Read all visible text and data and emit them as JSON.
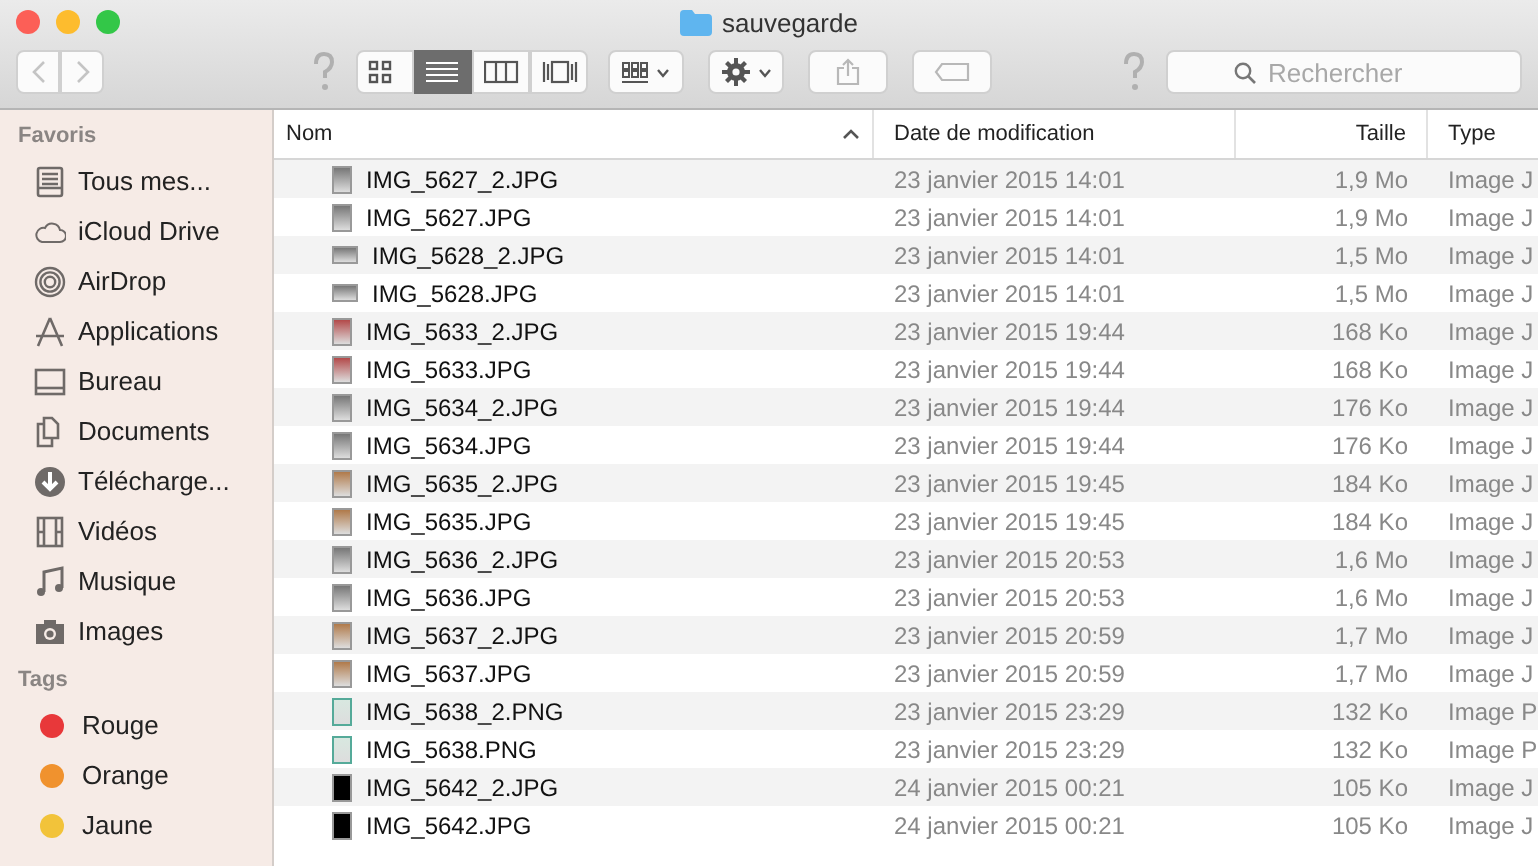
{
  "window": {
    "title": "sauvegarde"
  },
  "toolbar": {
    "view_modes": [
      {
        "kind": "icons",
        "selected": false
      },
      {
        "kind": "list",
        "selected": true
      },
      {
        "kind": "columns",
        "selected": false
      },
      {
        "kind": "coverflow",
        "selected": false
      }
    ],
    "search": {
      "placeholder": "Rechercher"
    }
  },
  "sidebar": {
    "sections": [
      {
        "title": "Favoris",
        "items": [
          {
            "kind": "all",
            "label": "Tous mes..."
          },
          {
            "kind": "cloud",
            "label": "iCloud Drive"
          },
          {
            "kind": "airdrop",
            "label": "AirDrop"
          },
          {
            "kind": "apps",
            "label": "Applications"
          },
          {
            "kind": "desktop",
            "label": "Bureau"
          },
          {
            "kind": "docs",
            "label": "Documents"
          },
          {
            "kind": "download",
            "label": "Télécharge..."
          },
          {
            "kind": "movies",
            "label": "Vidéos"
          },
          {
            "kind": "music",
            "label": "Musique"
          },
          {
            "kind": "pictures",
            "label": "Images"
          }
        ]
      },
      {
        "title": "Tags",
        "items": [
          {
            "kind": "tag",
            "label": "Rouge",
            "color": "#e8383a"
          },
          {
            "kind": "tag",
            "label": "Orange",
            "color": "#f0922e"
          },
          {
            "kind": "tag",
            "label": "Jaune",
            "color": "#f2c33a"
          }
        ]
      }
    ]
  },
  "table": {
    "columns": [
      {
        "label": "Nom",
        "sorted": true
      },
      {
        "label": "Date de modification",
        "sorted": false
      },
      {
        "label": "Taille",
        "sorted": false
      },
      {
        "label": "Type",
        "sorted": false
      }
    ],
    "rows": [
      {
        "kind": "portrait",
        "name": "IMG_5627_2.JPG",
        "date": "23 janvier 2015 14:01",
        "size": "1,9 Mo",
        "type": "Image J"
      },
      {
        "kind": "portrait",
        "name": "IMG_5627.JPG",
        "date": "23 janvier 2015 14:01",
        "size": "1,9 Mo",
        "type": "Image J"
      },
      {
        "kind": "landscape",
        "name": "IMG_5628_2.JPG",
        "date": "23 janvier 2015 14:01",
        "size": "1,5 Mo",
        "type": "Image J"
      },
      {
        "kind": "landscape",
        "name": "IMG_5628.JPG",
        "date": "23 janvier 2015 14:01",
        "size": "1,5 Mo",
        "type": "Image J"
      },
      {
        "kind": "red",
        "name": "IMG_5633_2.JPG",
        "date": "23 janvier 2015 19:44",
        "size": "168 Ko",
        "type": "Image J"
      },
      {
        "kind": "red",
        "name": "IMG_5633.JPG",
        "date": "23 janvier 2015 19:44",
        "size": "168 Ko",
        "type": "Image J"
      },
      {
        "kind": "portrait",
        "name": "IMG_5634_2.JPG",
        "date": "23 janvier 2015 19:44",
        "size": "176 Ko",
        "type": "Image J"
      },
      {
        "kind": "portrait",
        "name": "IMG_5634.JPG",
        "date": "23 janvier 2015 19:44",
        "size": "176 Ko",
        "type": "Image J"
      },
      {
        "kind": "warm",
        "name": "IMG_5635_2.JPG",
        "date": "23 janvier 2015 19:45",
        "size": "184 Ko",
        "type": "Image J"
      },
      {
        "kind": "warm",
        "name": "IMG_5635.JPG",
        "date": "23 janvier 2015 19:45",
        "size": "184 Ko",
        "type": "Image J"
      },
      {
        "kind": "portrait",
        "name": "IMG_5636_2.JPG",
        "date": "23 janvier 2015 20:53",
        "size": "1,6 Mo",
        "type": "Image J"
      },
      {
        "kind": "portrait",
        "name": "IMG_5636.JPG",
        "date": "23 janvier 2015 20:53",
        "size": "1,6 Mo",
        "type": "Image J"
      },
      {
        "kind": "warm",
        "name": "IMG_5637_2.JPG",
        "date": "23 janvier 2015 20:59",
        "size": "1,7 Mo",
        "type": "Image J"
      },
      {
        "kind": "warm",
        "name": "IMG_5637.JPG",
        "date": "23 janvier 2015 20:59",
        "size": "1,7 Mo",
        "type": "Image J"
      },
      {
        "kind": "screen",
        "name": "IMG_5638_2.PNG",
        "date": "23 janvier 2015 23:29",
        "size": "132 Ko",
        "type": "Image P"
      },
      {
        "kind": "screen",
        "name": "IMG_5638.PNG",
        "date": "23 janvier 2015 23:29",
        "size": "132 Ko",
        "type": "Image P"
      },
      {
        "kind": "black",
        "name": "IMG_5642_2.JPG",
        "date": "24 janvier 2015 00:21",
        "size": "105 Ko",
        "type": "Image J"
      },
      {
        "kind": "black",
        "name": "IMG_5642.JPG",
        "date": "24 janvier 2015 00:21",
        "size": "105 Ko",
        "type": "Image J"
      }
    ]
  }
}
